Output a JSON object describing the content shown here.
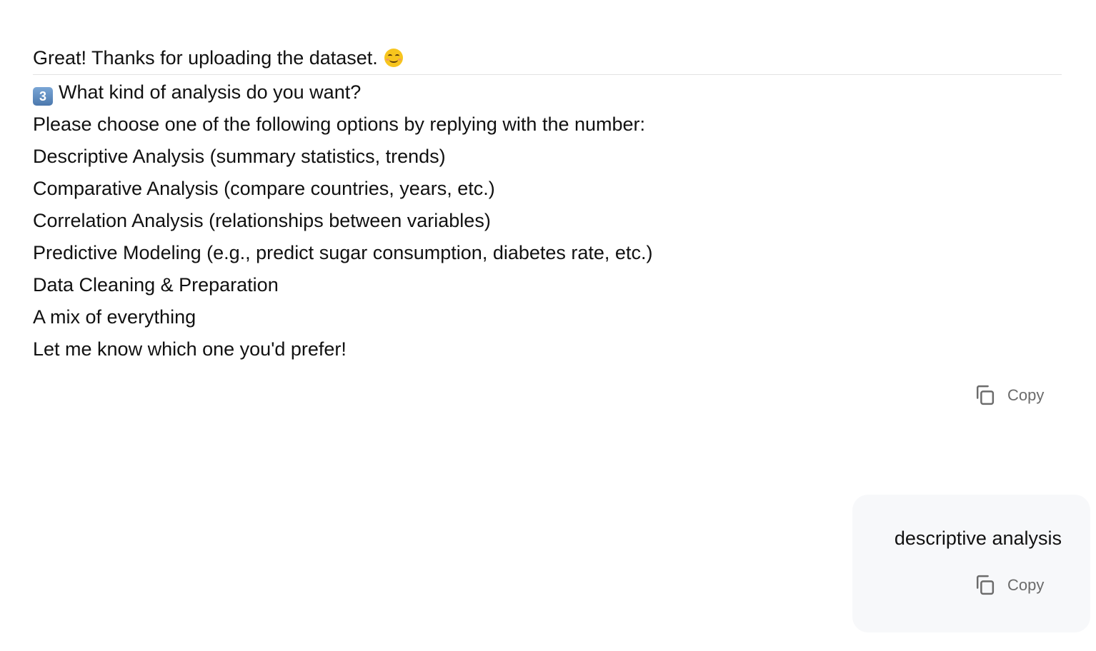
{
  "assistant": {
    "greeting": "Great! Thanks for uploading the dataset.",
    "greeting_emoji": "smiling-face-emoji",
    "question_badge": "3",
    "question": "What kind of analysis do you want?",
    "instruction": "Please choose one of the following options by replying with the number:",
    "options": [
      "Descriptive Analysis (summary statistics, trends)",
      "Comparative Analysis (compare countries, years, etc.)",
      "Correlation Analysis (relationships between variables)",
      "Predictive Modeling (e.g., predict sugar consumption, diabetes rate, etc.)",
      "Data Cleaning & Preparation",
      "A mix of everything"
    ],
    "closing": "Let me know which one you'd prefer!",
    "copy_label": "Copy",
    "copy_icon": "copy-icon"
  },
  "user": {
    "message": "descriptive analysis",
    "copy_label": "Copy",
    "copy_icon": "copy-icon"
  },
  "colors": {
    "text": "#111111",
    "muted": "#6b6b6b",
    "user_bubble": "#f7f8fa",
    "divider": "#e3e3e3"
  }
}
